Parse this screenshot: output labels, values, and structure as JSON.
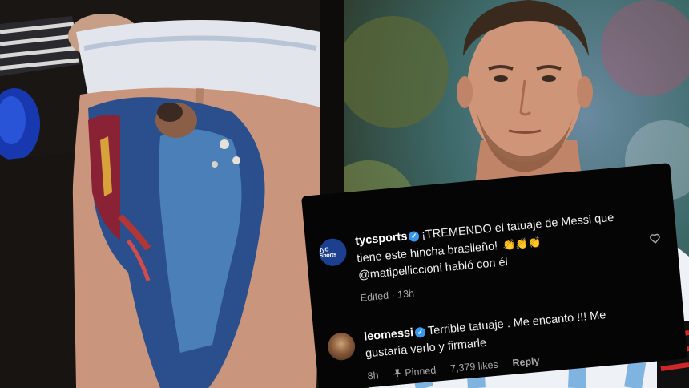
{
  "comments": [
    {
      "avatar_text": "TyC Sports",
      "username": "tycsports",
      "text_line1": "¡TREMENDO el tatuaje de Messi que",
      "text_line2": "tiene este hincha brasileño!",
      "text_line3": "@matipelliccioni habló con él",
      "status": "Edited",
      "time": "13h"
    },
    {
      "username": "leomessi",
      "text_line1": "Terrible tatuaje . Me encanto !!! Me",
      "text_line2": "gustaría verlo y firmarle",
      "time": "8h",
      "pinned_label": "Pinned",
      "likes": "7,379 likes",
      "reply_label": "Reply"
    }
  ],
  "icons": {
    "verified": "verified-badge",
    "clap": "clapping-hands",
    "heart": "heart-outline",
    "pin": "pin"
  },
  "colors": {
    "card_bg": "#050505",
    "verified_blue": "#3897f0",
    "secondary_text": "#a8a8a8"
  }
}
